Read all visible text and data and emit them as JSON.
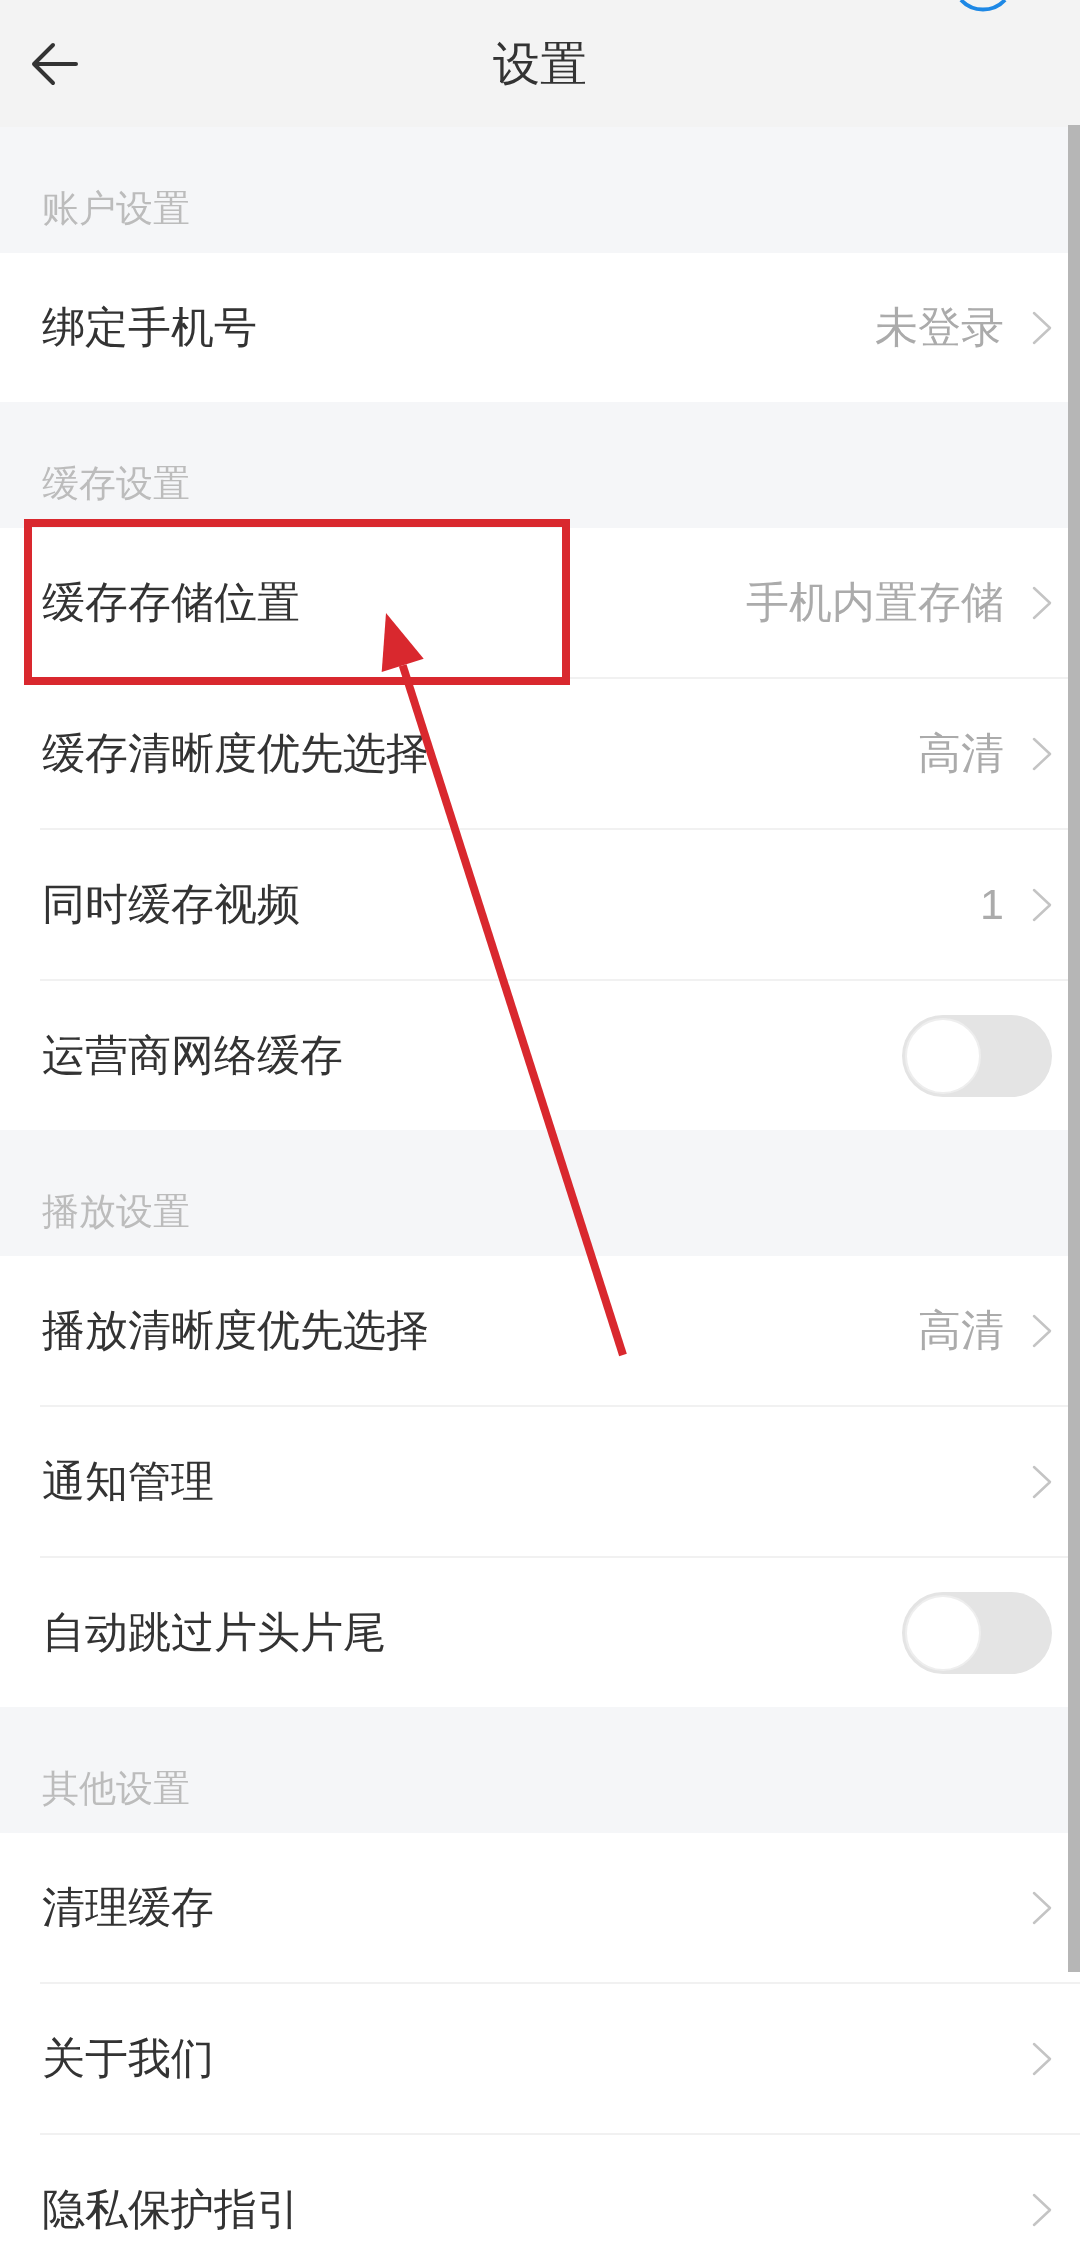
{
  "header": {
    "title": "设置"
  },
  "sections": [
    {
      "title": "账户设置",
      "rows": [
        {
          "kind": "link",
          "label": "绑定手机号",
          "value": "未登录"
        }
      ]
    },
    {
      "title": "缓存设置",
      "rows": [
        {
          "kind": "link",
          "label": "缓存存储位置",
          "value": "手机内置存储"
        },
        {
          "kind": "link",
          "label": "缓存清晰度优先选择",
          "value": "高清"
        },
        {
          "kind": "link",
          "label": "同时缓存视频",
          "value": "1"
        },
        {
          "kind": "toggle",
          "label": "运营商网络缓存",
          "on": false
        }
      ]
    },
    {
      "title": "播放设置",
      "rows": [
        {
          "kind": "link",
          "label": "播放清晰度优先选择",
          "value": "高清"
        },
        {
          "kind": "link",
          "label": "通知管理"
        },
        {
          "kind": "toggle",
          "label": "自动跳过片头片尾",
          "on": false
        }
      ]
    },
    {
      "title": "其他设置",
      "rows": [
        {
          "kind": "link",
          "label": "清理缓存"
        },
        {
          "kind": "link",
          "label": "关于我们"
        },
        {
          "kind": "link",
          "label": "隐私保护指引"
        }
      ]
    }
  ]
}
